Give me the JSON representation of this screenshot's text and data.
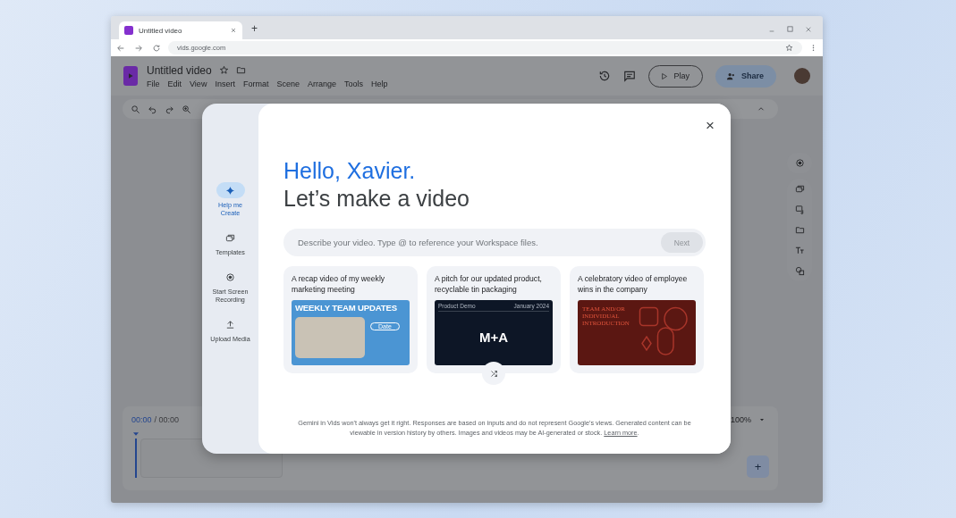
{
  "browser": {
    "tab_title": "Untitled video",
    "new_tab": "+",
    "url": "vids.google.com"
  },
  "app": {
    "doc_title": "Untitled video",
    "menu": [
      "File",
      "Edit",
      "View",
      "Insert",
      "Format",
      "Scene",
      "Arrange",
      "Tools",
      "Help"
    ],
    "play": "Play",
    "share": "Share"
  },
  "timeline": {
    "current_time": "00:00",
    "total_time": "/ 00:00",
    "zoom": "100%",
    "add": "+"
  },
  "dialog": {
    "nav": [
      {
        "label": "Help me Create",
        "kind": "sparkle",
        "selected": true
      },
      {
        "label": "Templates",
        "kind": "templates",
        "selected": false
      },
      {
        "label": "Start Screen Recording",
        "kind": "record",
        "selected": false
      },
      {
        "label": "Upload Media",
        "kind": "upload",
        "selected": false
      }
    ],
    "close": "×",
    "greeting": "Hello, Xavier.",
    "headline": "Let’s make a video",
    "prompt": {
      "placeholder": "Describe your video. Type @ to reference your Workspace files.",
      "button": "Next"
    },
    "suggestions": [
      {
        "caption": "A recap video of my weekly marketing meeting",
        "kind": "weekly",
        "thumb_title": "WEEKLY TEAM UPDATES",
        "thumb_label": "Date"
      },
      {
        "caption": "A pitch for our updated product, recyclable tin packaging",
        "kind": "pitch",
        "thumb_left": "Product Demo",
        "thumb_right": "January 2024",
        "thumb_title": "M+A"
      },
      {
        "caption": "A celebratory video of employee wins in the company",
        "kind": "celebrate",
        "thumb_title": "TEAM AND/OR INDIVIDUAL INTRODUCTION"
      }
    ],
    "disclaimer": "Gemini in Vids won't always get it right. Responses are based on inputs and do not represent Google's views. Generated content can be viewable in version history by others. Images and videos may be AI-generated or stock.",
    "link": "Learn more",
    "after_link": "."
  }
}
